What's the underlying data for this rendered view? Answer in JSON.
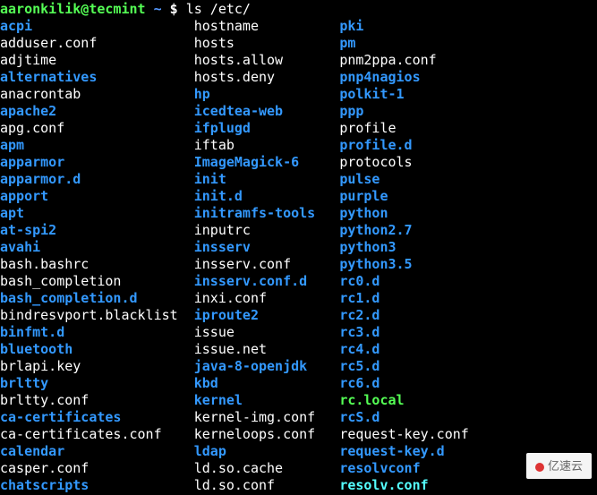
{
  "prompt": {
    "user_host": "aaronkilik@tecmint",
    "tilde": "~",
    "dollar": "$",
    "command": "ls /etc/"
  },
  "watermark": "亿速云",
  "columns_x": [
    0,
    241,
    421
  ],
  "char_w": 10,
  "listing": [
    [
      {
        "n": "acpi",
        "t": "dir"
      },
      {
        "n": "hostname",
        "t": "file"
      },
      {
        "n": "pki",
        "t": "dir"
      }
    ],
    [
      {
        "n": "adduser.conf",
        "t": "file"
      },
      {
        "n": "hosts",
        "t": "file"
      },
      {
        "n": "pm",
        "t": "dir"
      }
    ],
    [
      {
        "n": "adjtime",
        "t": "file"
      },
      {
        "n": "hosts.allow",
        "t": "file"
      },
      {
        "n": "pnm2ppa.conf",
        "t": "file"
      }
    ],
    [
      {
        "n": "alternatives",
        "t": "dir"
      },
      {
        "n": "hosts.deny",
        "t": "file"
      },
      {
        "n": "pnp4nagios",
        "t": "dir"
      }
    ],
    [
      {
        "n": "anacrontab",
        "t": "file"
      },
      {
        "n": "hp",
        "t": "dir"
      },
      {
        "n": "polkit-1",
        "t": "dir"
      }
    ],
    [
      {
        "n": "apache2",
        "t": "dir"
      },
      {
        "n": "icedtea-web",
        "t": "dir"
      },
      {
        "n": "ppp",
        "t": "dir"
      }
    ],
    [
      {
        "n": "apg.conf",
        "t": "file"
      },
      {
        "n": "ifplugd",
        "t": "dir"
      },
      {
        "n": "profile",
        "t": "file"
      }
    ],
    [
      {
        "n": "apm",
        "t": "dir"
      },
      {
        "n": "iftab",
        "t": "file"
      },
      {
        "n": "profile.d",
        "t": "dir"
      }
    ],
    [
      {
        "n": "apparmor",
        "t": "dir"
      },
      {
        "n": "ImageMagick-6",
        "t": "dir"
      },
      {
        "n": "protocols",
        "t": "file"
      }
    ],
    [
      {
        "n": "apparmor.d",
        "t": "dir"
      },
      {
        "n": "init",
        "t": "dir"
      },
      {
        "n": "pulse",
        "t": "dir"
      }
    ],
    [
      {
        "n": "apport",
        "t": "dir"
      },
      {
        "n": "init.d",
        "t": "dir"
      },
      {
        "n": "purple",
        "t": "dir"
      }
    ],
    [
      {
        "n": "apt",
        "t": "dir"
      },
      {
        "n": "initramfs-tools",
        "t": "dir"
      },
      {
        "n": "python",
        "t": "dir"
      }
    ],
    [
      {
        "n": "at-spi2",
        "t": "dir"
      },
      {
        "n": "inputrc",
        "t": "file"
      },
      {
        "n": "python2.7",
        "t": "dir"
      }
    ],
    [
      {
        "n": "avahi",
        "t": "dir"
      },
      {
        "n": "insserv",
        "t": "dir"
      },
      {
        "n": "python3",
        "t": "dir"
      }
    ],
    [
      {
        "n": "bash.bashrc",
        "t": "file"
      },
      {
        "n": "insserv.conf",
        "t": "file"
      },
      {
        "n": "python3.5",
        "t": "dir"
      }
    ],
    [
      {
        "n": "bash_completion",
        "t": "file"
      },
      {
        "n": "insserv.conf.d",
        "t": "dir"
      },
      {
        "n": "rc0.d",
        "t": "dir"
      }
    ],
    [
      {
        "n": "bash_completion.d",
        "t": "dir"
      },
      {
        "n": "inxi.conf",
        "t": "file"
      },
      {
        "n": "rc1.d",
        "t": "dir"
      }
    ],
    [
      {
        "n": "bindresvport.blacklist",
        "t": "file"
      },
      {
        "n": "iproute2",
        "t": "dir"
      },
      {
        "n": "rc2.d",
        "t": "dir"
      }
    ],
    [
      {
        "n": "binfmt.d",
        "t": "dir"
      },
      {
        "n": "issue",
        "t": "file"
      },
      {
        "n": "rc3.d",
        "t": "dir"
      }
    ],
    [
      {
        "n": "bluetooth",
        "t": "dir"
      },
      {
        "n": "issue.net",
        "t": "file"
      },
      {
        "n": "rc4.d",
        "t": "dir"
      }
    ],
    [
      {
        "n": "brlapi.key",
        "t": "file"
      },
      {
        "n": "java-8-openjdk",
        "t": "dir"
      },
      {
        "n": "rc5.d",
        "t": "dir"
      }
    ],
    [
      {
        "n": "brltty",
        "t": "dir"
      },
      {
        "n": "kbd",
        "t": "dir"
      },
      {
        "n": "rc6.d",
        "t": "dir"
      }
    ],
    [
      {
        "n": "brltty.conf",
        "t": "file"
      },
      {
        "n": "kernel",
        "t": "dir"
      },
      {
        "n": "rc.local",
        "t": "exec"
      }
    ],
    [
      {
        "n": "ca-certificates",
        "t": "dir"
      },
      {
        "n": "kernel-img.conf",
        "t": "file"
      },
      {
        "n": "rcS.d",
        "t": "dir"
      }
    ],
    [
      {
        "n": "ca-certificates.conf",
        "t": "file"
      },
      {
        "n": "kerneloops.conf",
        "t": "file"
      },
      {
        "n": "request-key.conf",
        "t": "file"
      }
    ],
    [
      {
        "n": "calendar",
        "t": "dir"
      },
      {
        "n": "ldap",
        "t": "dir"
      },
      {
        "n": "request-key.d",
        "t": "dir"
      }
    ],
    [
      {
        "n": "casper.conf",
        "t": "file"
      },
      {
        "n": "ld.so.cache",
        "t": "file"
      },
      {
        "n": "resolvconf",
        "t": "dir"
      }
    ],
    [
      {
        "n": "chatscripts",
        "t": "dir"
      },
      {
        "n": "ld.so.conf",
        "t": "file"
      },
      {
        "n": "resolv.conf",
        "t": "link"
      }
    ]
  ]
}
